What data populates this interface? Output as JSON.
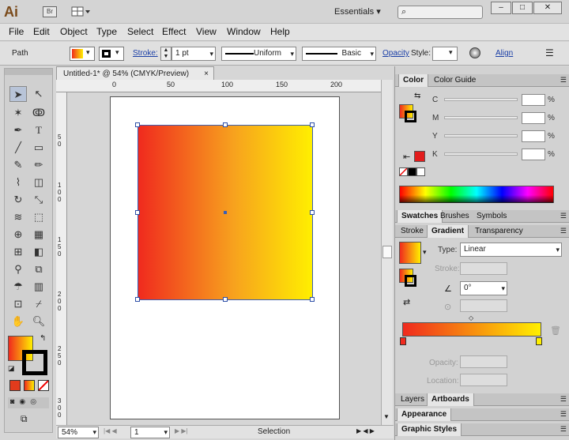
{
  "app": {
    "logo": "Ai",
    "bridge": "Br",
    "workspace": "Essentials"
  },
  "window_buttons": [
    "–",
    "□",
    "✕"
  ],
  "menu": [
    "File",
    "Edit",
    "Object",
    "Type",
    "Select",
    "Effect",
    "View",
    "Window",
    "Help"
  ],
  "control": {
    "selection": "Path",
    "stroke_label": "Stroke:",
    "stroke_weight": "1 pt",
    "profile": "Uniform",
    "brush": "Basic",
    "opacity_label": "Opacity",
    "style_label": "Style:",
    "align_label": "Align"
  },
  "document": {
    "tab_title": "Untitled-1* @ 54% (CMYK/Preview)",
    "close": "×"
  },
  "ruler_h": [
    "0",
    "50",
    "100",
    "150",
    "200"
  ],
  "ruler_v": [
    "5\n0",
    "1\n0\n0",
    "1\n5\n0",
    "2\n0\n0",
    "2\n5\n0",
    "3\n0\n0"
  ],
  "status": {
    "zoom": "54%",
    "page": "1",
    "mode": "Selection"
  },
  "panels": {
    "color_tabs": [
      "Color",
      "Color Guide"
    ],
    "cmyk": [
      "C",
      "M",
      "Y",
      "K"
    ],
    "swatch_tabs": [
      "Swatches",
      "Brushes",
      "Symbols"
    ],
    "gradient_tabs": [
      "Stroke",
      "Gradient",
      "Transparency"
    ],
    "type_label": "Type:",
    "type_value": "Linear",
    "stroke_label": "Stroke:",
    "angle_value": "0°",
    "opacity_label": "Opacity:",
    "location_label": "Location:",
    "bottom_tabs": [
      "Layers",
      "Artboards"
    ],
    "appearance": "Appearance",
    "graphic_styles": "Graphic Styles"
  },
  "colors": {
    "grad_start": "#f02a1e",
    "grad_end": "#ffef00",
    "accent_link": "#1a3ea6"
  }
}
